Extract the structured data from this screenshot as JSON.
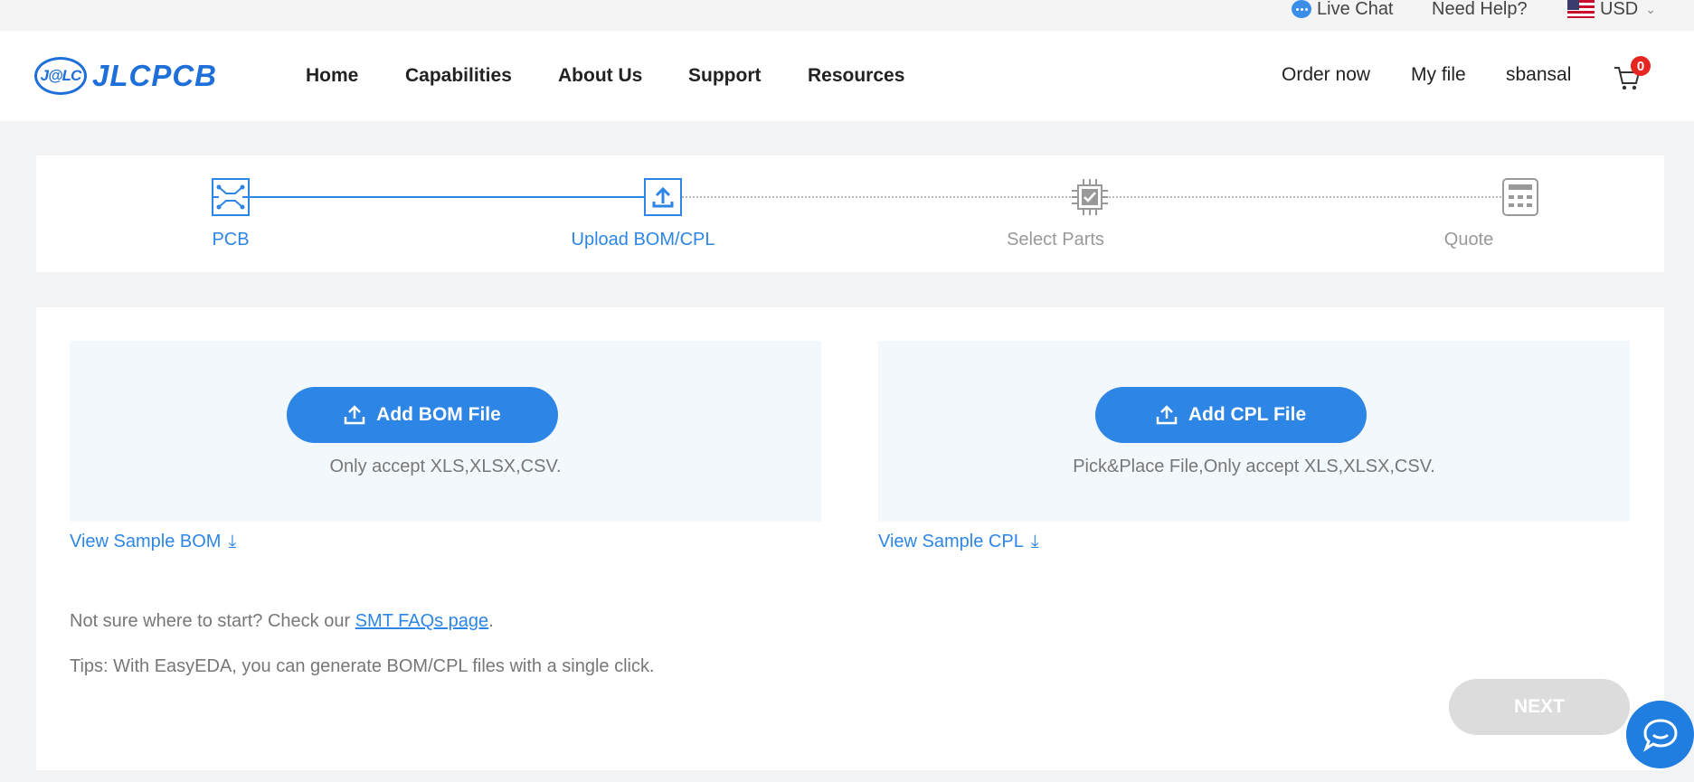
{
  "topbar": {
    "live_chat": "Live Chat",
    "need_help": "Need Help?",
    "currency": "USD"
  },
  "nav": {
    "logo_mark": "J@LC",
    "logo_text": "JLCPCB",
    "links": [
      "Home",
      "Capabilities",
      "About Us",
      "Support",
      "Resources"
    ],
    "order_now": "Order now",
    "my_file": "My file",
    "username": "sbansal",
    "cart_count": "0"
  },
  "steps": [
    {
      "label": "PCB",
      "state": "done",
      "icon": "pcb-circuit-icon"
    },
    {
      "label": "Upload BOM/CPL",
      "state": "active",
      "icon": "upload-icon"
    },
    {
      "label": "Select Parts",
      "state": "pending",
      "icon": "chip-check-icon"
    },
    {
      "label": "Quote",
      "state": "pending",
      "icon": "calculator-icon"
    }
  ],
  "bom": {
    "button": "Add BOM File",
    "note": "Only accept XLS,XLSX,CSV.",
    "sample": "View Sample BOM"
  },
  "cpl": {
    "button": "Add CPL File",
    "note": "Pick&Place File,Only accept XLS,XLSX,CSV.",
    "sample": "View Sample CPL"
  },
  "help": {
    "prefix": "Not sure where to start? Check our ",
    "link": "SMT FAQs page",
    "suffix": ".",
    "tips": "Tips: With EasyEDA, you can generate BOM/CPL files with a single click."
  },
  "next_button": "NEXT",
  "colors": {
    "accent": "#2d86e6",
    "badge": "#e5251f",
    "disabled": "#dcdcdc"
  }
}
